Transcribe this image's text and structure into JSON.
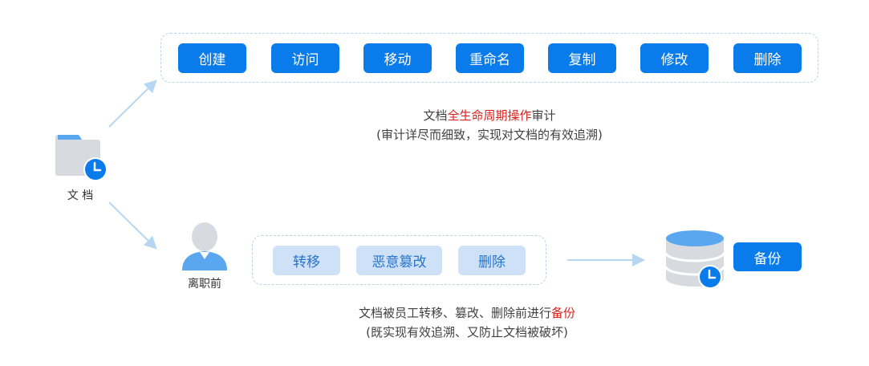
{
  "doc_node": {
    "label": "文 档",
    "icon": "folder-clock-icon"
  },
  "top_flow": {
    "actions": [
      "创建",
      "访问",
      "移动",
      "重命名",
      "复制",
      "修改",
      "删除"
    ],
    "caption_prefix": "文档",
    "caption_highlight": "全生命周期操作",
    "caption_suffix": "审计",
    "caption_sub": "(审计详尽而细致，实现对文档的有效追溯)"
  },
  "bottom_flow": {
    "person_label": "离职前",
    "actions": [
      "转移",
      "恶意篡改",
      "删除"
    ],
    "backup_label": "备份",
    "caption_prefix": "文档被员工转移、篡改、删除前进行",
    "caption_highlight": "备份",
    "caption_sub": "(既实现有效追溯、又防止文档被破坏)"
  },
  "colors": {
    "primary": "#0a7bea",
    "light_button": "#cfe1f7",
    "dashed_border": "#b9d4ec",
    "arrow": "#b7d6f1",
    "highlight": "#d8211d",
    "icon_gray": "#d7dade"
  }
}
